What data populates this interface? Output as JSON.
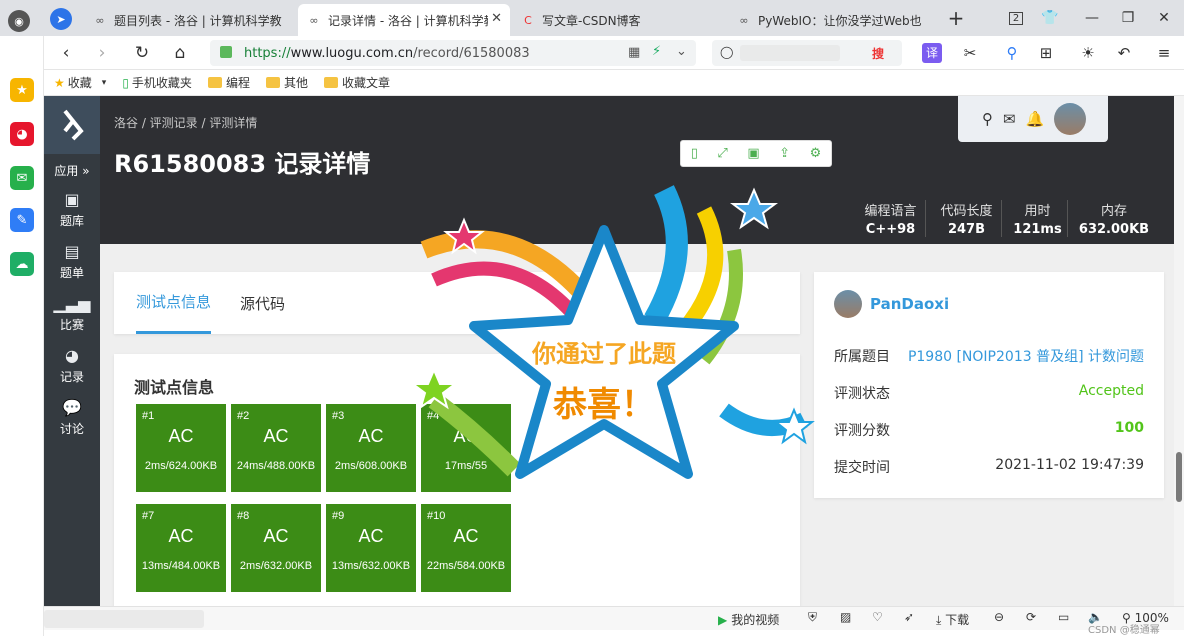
{
  "tabs": [
    {
      "label": "题目列表 - 洛谷 | 计算机科学教"
    },
    {
      "label": "记录详情 - 洛谷 | 计算机科学教"
    },
    {
      "label": "写文章-CSDN博客"
    },
    {
      "label": "PyWebIO：让你没学过Web也"
    }
  ],
  "tab_close": "✕",
  "tab_new": "+",
  "tab_counter": "2",
  "address": {
    "protocol": "https://",
    "domain": "www.luogu.com.cn",
    "path": "/record/61580083"
  },
  "search_engine": "搜",
  "translate": "译",
  "bookmarks": [
    {
      "label": "收藏"
    },
    {
      "label": "手机收藏夹"
    },
    {
      "label": "编程"
    },
    {
      "label": "其他"
    },
    {
      "label": "收藏文章"
    }
  ],
  "site": {
    "nav": [
      {
        "label": "应用 »",
        "icon": "apps-icon"
      },
      {
        "label": "题库",
        "icon": "book-icon"
      },
      {
        "label": "题单",
        "icon": "clipboard-icon"
      },
      {
        "label": "比赛",
        "icon": "bar-chart-icon"
      },
      {
        "label": "记录",
        "icon": "pie-chart-icon"
      },
      {
        "label": "讨论",
        "icon": "chat-icon"
      }
    ],
    "breadcrumb": "洛谷 / 评测记录 / 评测详情",
    "title": "R61580083 记录详情",
    "stats": [
      {
        "label": "编程语言",
        "value": "C++98"
      },
      {
        "label": "代码长度",
        "value": "247B"
      },
      {
        "label": "用时",
        "value": "121ms"
      },
      {
        "label": "内存",
        "value": "632.00KB"
      }
    ],
    "tabs": [
      "测试点信息",
      "源代码"
    ],
    "cases_title": "测试点信息",
    "cases": [
      {
        "id": "#1",
        "status": "AC",
        "detail": "2ms/624.00KB"
      },
      {
        "id": "#2",
        "status": "AC",
        "detail": "24ms/488.00KB"
      },
      {
        "id": "#3",
        "status": "AC",
        "detail": "2ms/608.00KB"
      },
      {
        "id": "#4",
        "status": "AC",
        "detail": "17ms/55"
      },
      {
        "id": "#7",
        "status": "AC",
        "detail": "13ms/484.00KB"
      },
      {
        "id": "#8",
        "status": "AC",
        "detail": "2ms/632.00KB"
      },
      {
        "id": "#9",
        "status": "AC",
        "detail": "13ms/632.00KB"
      },
      {
        "id": "#10",
        "status": "AC",
        "detail": "22ms/584.00KB"
      }
    ],
    "user": "PanDaoxi",
    "info": [
      {
        "label": "所属题目",
        "value": "P1980 [NOIP2013 普及组] 计数问题"
      },
      {
        "label": "评测状态",
        "value": "Accepted"
      },
      {
        "label": "评测分数",
        "value": "100"
      },
      {
        "label": "提交时间",
        "value": "2021-11-02 19:47:39"
      }
    ]
  },
  "popup": {
    "line1": "你通过了此题",
    "line2": "恭喜！"
  },
  "statusbar": {
    "video": "我的视频",
    "download": "下载",
    "zoom": "100%",
    "watermark": "CSDN @稳通幂"
  },
  "colors": {
    "ac_green": "#3c8c16",
    "accent_blue": "#3498db",
    "accepted": "#52c41a"
  }
}
